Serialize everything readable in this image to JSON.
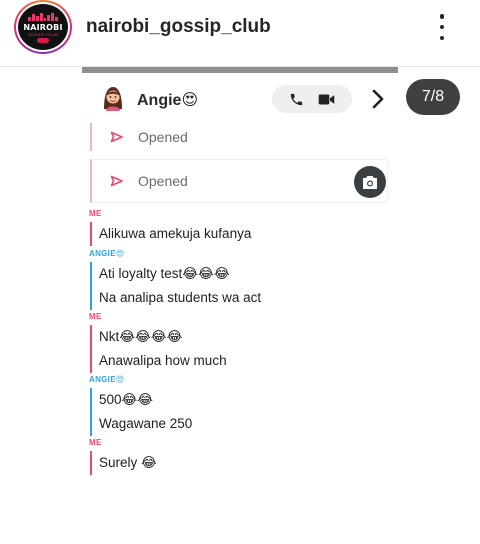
{
  "post": {
    "username": "nairobi_gossip_club",
    "avatar": {
      "logo_text": "NAIROBI",
      "logo_sub": "GOSSIP CLUB"
    },
    "more_icon": "more-vertical-icon",
    "counter": "7/8"
  },
  "chat": {
    "contact_name": "Angie😍",
    "opened_label_1": "Opened",
    "opened_label_2": "Opened",
    "icons": {
      "call": "phone-icon",
      "video": "video-icon",
      "next": "chevron-right-icon",
      "camera": "camera-icon",
      "opened": "triangle-outline-icon"
    },
    "messages": [
      {
        "sender": "ME",
        "lines": [
          "Alikuwa amekuja kufanya"
        ]
      },
      {
        "sender": "ANGIE😍",
        "lines": [
          "Ati loyalty test😂😂😂",
          "Na analipa students wa act"
        ]
      },
      {
        "sender": "ME",
        "lines": [
          "Nkt😂😂😂😂",
          "Anawalipa how much"
        ]
      },
      {
        "sender": "ANGIE😍",
        "lines": [
          "500😂😂",
          "Wagawane 250"
        ]
      },
      {
        "sender": "ME",
        "lines": [
          "Surely 😂"
        ]
      }
    ]
  },
  "colors": {
    "me": "#e84a6a",
    "angie": "#2ea4d8",
    "counter_bg": "#262626"
  }
}
